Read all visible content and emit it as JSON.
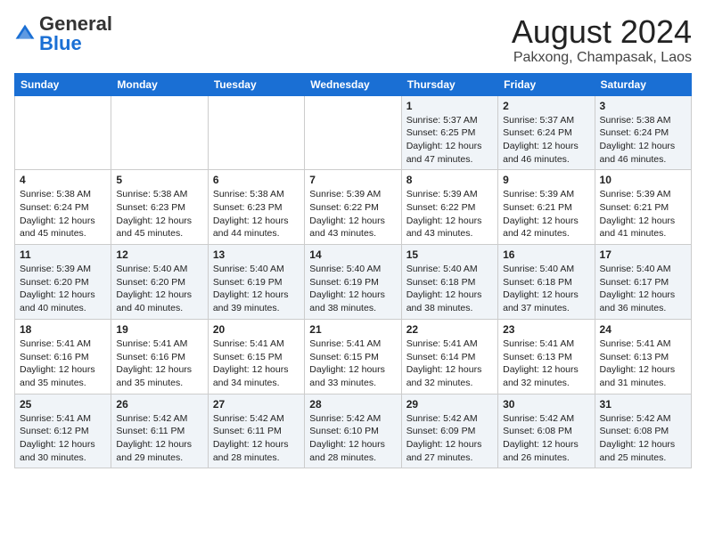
{
  "logo": {
    "general": "General",
    "blue": "Blue"
  },
  "header": {
    "month": "August 2024",
    "location": "Pakxong, Champasak, Laos"
  },
  "days_of_week": [
    "Sunday",
    "Monday",
    "Tuesday",
    "Wednesday",
    "Thursday",
    "Friday",
    "Saturday"
  ],
  "weeks": [
    [
      {
        "day": "",
        "info": ""
      },
      {
        "day": "",
        "info": ""
      },
      {
        "day": "",
        "info": ""
      },
      {
        "day": "",
        "info": ""
      },
      {
        "day": "1",
        "info": "Sunrise: 5:37 AM\nSunset: 6:25 PM\nDaylight: 12 hours\nand 47 minutes."
      },
      {
        "day": "2",
        "info": "Sunrise: 5:37 AM\nSunset: 6:24 PM\nDaylight: 12 hours\nand 46 minutes."
      },
      {
        "day": "3",
        "info": "Sunrise: 5:38 AM\nSunset: 6:24 PM\nDaylight: 12 hours\nand 46 minutes."
      }
    ],
    [
      {
        "day": "4",
        "info": "Sunrise: 5:38 AM\nSunset: 6:24 PM\nDaylight: 12 hours\nand 45 minutes."
      },
      {
        "day": "5",
        "info": "Sunrise: 5:38 AM\nSunset: 6:23 PM\nDaylight: 12 hours\nand 45 minutes."
      },
      {
        "day": "6",
        "info": "Sunrise: 5:38 AM\nSunset: 6:23 PM\nDaylight: 12 hours\nand 44 minutes."
      },
      {
        "day": "7",
        "info": "Sunrise: 5:39 AM\nSunset: 6:22 PM\nDaylight: 12 hours\nand 43 minutes."
      },
      {
        "day": "8",
        "info": "Sunrise: 5:39 AM\nSunset: 6:22 PM\nDaylight: 12 hours\nand 43 minutes."
      },
      {
        "day": "9",
        "info": "Sunrise: 5:39 AM\nSunset: 6:21 PM\nDaylight: 12 hours\nand 42 minutes."
      },
      {
        "day": "10",
        "info": "Sunrise: 5:39 AM\nSunset: 6:21 PM\nDaylight: 12 hours\nand 41 minutes."
      }
    ],
    [
      {
        "day": "11",
        "info": "Sunrise: 5:39 AM\nSunset: 6:20 PM\nDaylight: 12 hours\nand 40 minutes."
      },
      {
        "day": "12",
        "info": "Sunrise: 5:40 AM\nSunset: 6:20 PM\nDaylight: 12 hours\nand 40 minutes."
      },
      {
        "day": "13",
        "info": "Sunrise: 5:40 AM\nSunset: 6:19 PM\nDaylight: 12 hours\nand 39 minutes."
      },
      {
        "day": "14",
        "info": "Sunrise: 5:40 AM\nSunset: 6:19 PM\nDaylight: 12 hours\nand 38 minutes."
      },
      {
        "day": "15",
        "info": "Sunrise: 5:40 AM\nSunset: 6:18 PM\nDaylight: 12 hours\nand 38 minutes."
      },
      {
        "day": "16",
        "info": "Sunrise: 5:40 AM\nSunset: 6:18 PM\nDaylight: 12 hours\nand 37 minutes."
      },
      {
        "day": "17",
        "info": "Sunrise: 5:40 AM\nSunset: 6:17 PM\nDaylight: 12 hours\nand 36 minutes."
      }
    ],
    [
      {
        "day": "18",
        "info": "Sunrise: 5:41 AM\nSunset: 6:16 PM\nDaylight: 12 hours\nand 35 minutes."
      },
      {
        "day": "19",
        "info": "Sunrise: 5:41 AM\nSunset: 6:16 PM\nDaylight: 12 hours\nand 35 minutes."
      },
      {
        "day": "20",
        "info": "Sunrise: 5:41 AM\nSunset: 6:15 PM\nDaylight: 12 hours\nand 34 minutes."
      },
      {
        "day": "21",
        "info": "Sunrise: 5:41 AM\nSunset: 6:15 PM\nDaylight: 12 hours\nand 33 minutes."
      },
      {
        "day": "22",
        "info": "Sunrise: 5:41 AM\nSunset: 6:14 PM\nDaylight: 12 hours\nand 32 minutes."
      },
      {
        "day": "23",
        "info": "Sunrise: 5:41 AM\nSunset: 6:13 PM\nDaylight: 12 hours\nand 32 minutes."
      },
      {
        "day": "24",
        "info": "Sunrise: 5:41 AM\nSunset: 6:13 PM\nDaylight: 12 hours\nand 31 minutes."
      }
    ],
    [
      {
        "day": "25",
        "info": "Sunrise: 5:41 AM\nSunset: 6:12 PM\nDaylight: 12 hours\nand 30 minutes."
      },
      {
        "day": "26",
        "info": "Sunrise: 5:42 AM\nSunset: 6:11 PM\nDaylight: 12 hours\nand 29 minutes."
      },
      {
        "day": "27",
        "info": "Sunrise: 5:42 AM\nSunset: 6:11 PM\nDaylight: 12 hours\nand 28 minutes."
      },
      {
        "day": "28",
        "info": "Sunrise: 5:42 AM\nSunset: 6:10 PM\nDaylight: 12 hours\nand 28 minutes."
      },
      {
        "day": "29",
        "info": "Sunrise: 5:42 AM\nSunset: 6:09 PM\nDaylight: 12 hours\nand 27 minutes."
      },
      {
        "day": "30",
        "info": "Sunrise: 5:42 AM\nSunset: 6:08 PM\nDaylight: 12 hours\nand 26 minutes."
      },
      {
        "day": "31",
        "info": "Sunrise: 5:42 AM\nSunset: 6:08 PM\nDaylight: 12 hours\nand 25 minutes."
      }
    ]
  ]
}
